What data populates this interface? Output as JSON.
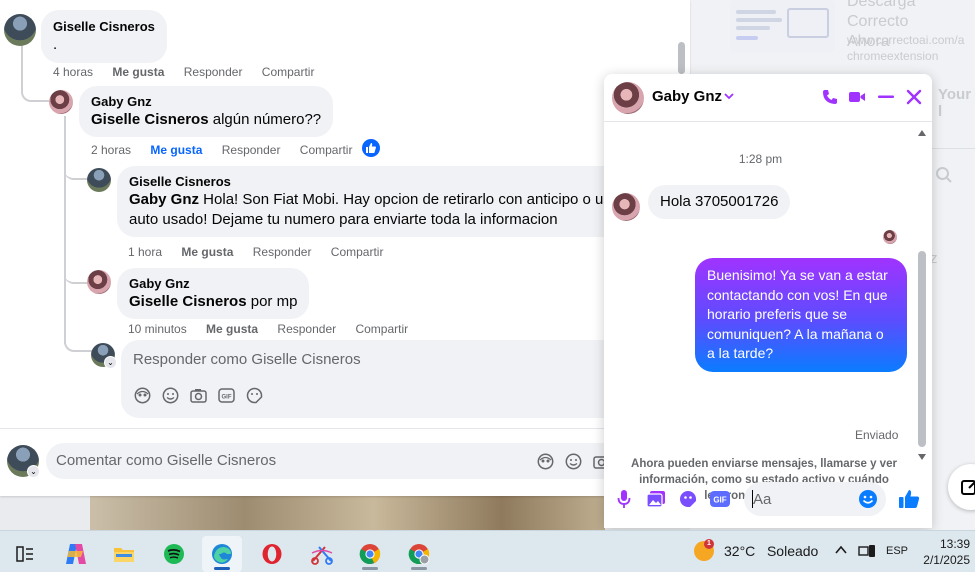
{
  "background": {
    "ad_title": "Descarga Correcto",
    "ad_title_2": "Ahora",
    "ad_url": "www.correctoai.com/a",
    "ad_url_2": "chromeextension",
    "right_label": "Your l",
    "right_label_2": "z"
  },
  "comments": [
    {
      "author": "Giselle Cisneros",
      "text": ".",
      "time": "4 horas",
      "like": "Me gusta",
      "reply": "Responder",
      "share": "Compartir"
    },
    {
      "author": "Gaby Gnz",
      "mention": "Giselle Cisneros",
      "text": " algún número??",
      "time": "2 horas",
      "like": "Me gusta",
      "reply": "Responder",
      "share": "Compartir",
      "liked": true
    },
    {
      "author": "Giselle Cisneros",
      "mention": "Gaby Gnz",
      "text_line1": " Hola! Son Fiat Mobi. Hay opcion de retirarlo con anticipo o un",
      "text_line2": "auto usado! Dejame tu numero para enviarte toda la informacion",
      "time": "1 hora",
      "like": "Me gusta",
      "reply": "Responder",
      "share": "Compartir"
    },
    {
      "author": "Gaby Gnz",
      "mention": "Giselle Cisneros",
      "text": " por mp",
      "time": "10 minutos",
      "like": "Me gusta",
      "reply": "Responder",
      "share": "Compartir"
    }
  ],
  "reply_box": {
    "placeholder": "Responder como Giselle Cisneros",
    "tools": [
      "avatar-sticker-icon",
      "emoji-icon",
      "camera-icon",
      "gif-icon",
      "sticker-icon"
    ]
  },
  "comment_box": {
    "placeholder": "Comentar como Giselle Cisneros"
  },
  "chat": {
    "contact_name": "Gaby Gnz",
    "time_label": "1:28 pm",
    "incoming_message": "Hola 3705001726",
    "outgoing_message": "Buenisimo! Ya se van a estar contactando con vos! En que horario preferis que se comuniquen? A la mañana o a la tarde?",
    "status": "Enviado",
    "notice": "Ahora pueden enviarse mensajes, llamarse y ver información, como su estado activo y cuándo leyeron los mensajes.",
    "input_placeholder": "Aa",
    "accent_color": "#a033ff"
  },
  "taskbar": {
    "apps": [
      "task-view-icon",
      "copilot-icon",
      "file-explorer-icon",
      "spotify-icon",
      "edge-icon",
      "opera-icon",
      "snipping-tool-icon",
      "chrome-icon",
      "chrome-profile-icon"
    ],
    "weather_temp": "32°C",
    "weather_text": "Soleado",
    "weather_badge": "1",
    "language": "ESP",
    "time": "13:39",
    "date": "2/1/2025"
  }
}
